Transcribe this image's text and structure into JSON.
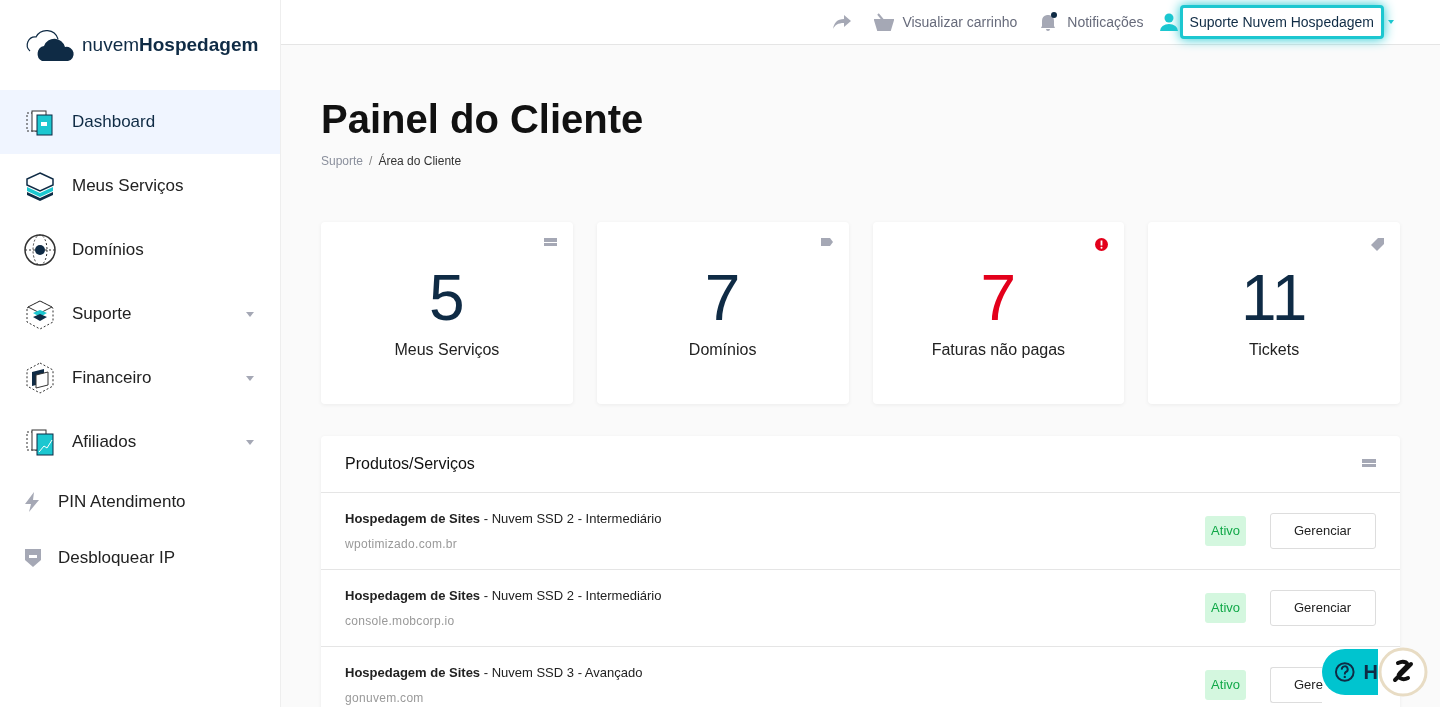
{
  "logo": {
    "light": "nuvem",
    "bold": "Hospedagem"
  },
  "sidebar": {
    "items": [
      {
        "label": "Dashboard",
        "selected": true,
        "expandable": false
      },
      {
        "label": "Meus Serviços",
        "selected": false,
        "expandable": false
      },
      {
        "label": "Domínios",
        "selected": false,
        "expandable": false
      },
      {
        "label": "Suporte",
        "selected": false,
        "expandable": true
      },
      {
        "label": "Financeiro",
        "selected": false,
        "expandable": true
      },
      {
        "label": "Afiliados",
        "selected": false,
        "expandable": true
      },
      {
        "label": "PIN Atendimento",
        "selected": false,
        "expandable": false
      },
      {
        "label": "Desbloquear IP",
        "selected": false,
        "expandable": false
      }
    ]
  },
  "topbar": {
    "cart": "Visualizar carrinho",
    "notifications": "Notificações",
    "has_unread": true,
    "user": "Suporte Nuvem Hospedagem"
  },
  "page": {
    "title": "Painel do Cliente",
    "breadcrumb": [
      "Suporte",
      "Área do Cliente"
    ],
    "breadcrumb_separator": "/"
  },
  "stats": [
    {
      "value": "5",
      "label": "Meus Serviços",
      "alert": false
    },
    {
      "value": "7",
      "label": "Domínios",
      "alert": false
    },
    {
      "value": "7",
      "label": "Faturas não pagas",
      "alert": true
    },
    {
      "value": "11",
      "label": "Tickets",
      "alert": false
    }
  ],
  "products": {
    "title": "Produtos/Serviços",
    "rows": [
      {
        "product": "Hospedagem de Sites",
        "plan": " - Nuvem SSD 2 - Intermediário",
        "domain": "wpotimizado.com.br",
        "status": "Ativo",
        "action": "Gerenciar"
      },
      {
        "product": "Hospedagem de Sites",
        "plan": " - Nuvem SSD 2 - Intermediário",
        "domain": "console.mobcorp.io",
        "status": "Ativo",
        "action": "Gerenciar"
      },
      {
        "product": "Hospedagem de Sites",
        "plan": " - Nuvem SSD 3 - Avançado",
        "domain": "gonuvem.com",
        "status": "Ativo",
        "action": "Gere"
      }
    ]
  },
  "help": {
    "label": "H"
  }
}
